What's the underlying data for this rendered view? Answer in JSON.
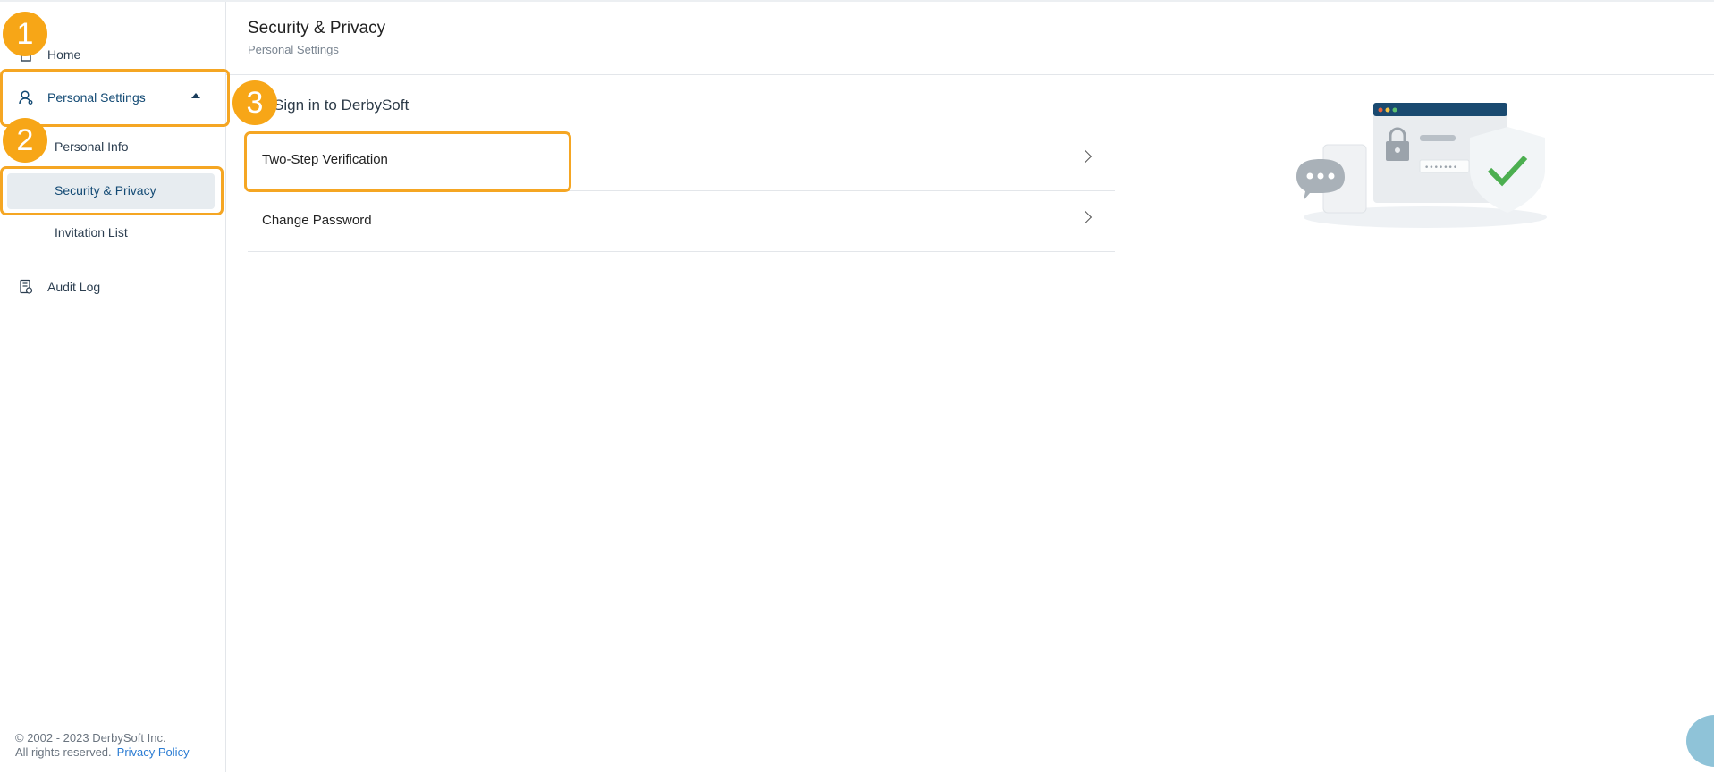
{
  "header": {
    "title": "Security & Privacy",
    "breadcrumb": "Personal Settings"
  },
  "sidebar": {
    "home": "Home",
    "personal_settings": "Personal Settings",
    "sub_items": [
      "Personal Info",
      "Security & Privacy",
      "Invitation List"
    ],
    "audit_log": "Audit Log"
  },
  "footer": {
    "copyright": "© 2002 - 2023 DerbySoft Inc.",
    "rights": "All rights reserved.",
    "privacy_link": "Privacy Policy"
  },
  "main": {
    "section_title": "Sign in to DerbySoft",
    "rows": [
      "Two-Step Verification",
      "Change Password"
    ]
  },
  "annotations": [
    "1",
    "2",
    "3"
  ],
  "colors": {
    "accent": "#f5a623",
    "brand": "#134a74",
    "active_bg": "#e7ecf0",
    "link": "#2b7cd3"
  }
}
